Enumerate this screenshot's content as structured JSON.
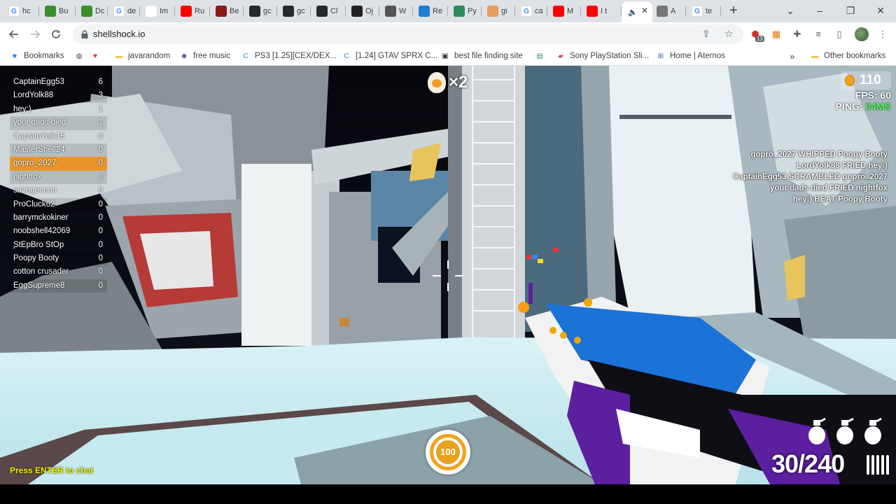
{
  "browser": {
    "tabs": [
      {
        "title": "hc",
        "icon": "google-icon",
        "color": "#ffffff"
      },
      {
        "title": "Bu",
        "icon": "minecraft-icon",
        "color": "#3c8f2a"
      },
      {
        "title": "Dc",
        "icon": "minecraft-icon",
        "color": "#3c8f2a"
      },
      {
        "title": "de",
        "icon": "google-icon",
        "color": "#ffffff"
      },
      {
        "title": "Im",
        "icon": "chart-icon",
        "color": "#ffffff"
      },
      {
        "title": "Ru",
        "icon": "youtube-icon",
        "color": "#ff0000"
      },
      {
        "title": "Be",
        "icon": "medium-icon",
        "color": "#8b1a1a"
      },
      {
        "title": "gc",
        "icon": "github-icon",
        "color": "#24292e"
      },
      {
        "title": "gc",
        "icon": "github-icon",
        "color": "#24292e"
      },
      {
        "title": "Cl",
        "icon": "github-icon",
        "color": "#24292e"
      },
      {
        "title": "Oj",
        "icon": "openai-icon",
        "color": "#222222"
      },
      {
        "title": "W",
        "icon": "globe-icon",
        "color": "#555555"
      },
      {
        "title": "Re",
        "icon": "react-icon",
        "color": "#1f7fd1"
      },
      {
        "title": "Py",
        "icon": "wolfram-icon",
        "color": "#2e8b57"
      },
      {
        "title": "gi",
        "icon": "hand-icon",
        "color": "#e89a5b"
      },
      {
        "title": "ca",
        "icon": "google-icon",
        "color": "#ffffff"
      },
      {
        "title": "M",
        "icon": "youtube-icon",
        "color": "#ff0000"
      },
      {
        "title": "I t",
        "icon": "youtube-icon",
        "color": "#ff0000"
      },
      {
        "title": "",
        "icon": "speaker-icon",
        "color": "#ffffff",
        "active": true
      },
      {
        "title": "A",
        "icon": "page-icon",
        "color": "#777777"
      },
      {
        "title": "te",
        "icon": "google-icon",
        "color": "#ffffff"
      }
    ],
    "new_tab": "+",
    "window_controls": {
      "dropdown": "⌄",
      "minimize": "–",
      "restore": "❐",
      "close": "✕"
    },
    "url": "shellshock.io",
    "bookmarks": [
      {
        "label": "Bookmarks",
        "icon": "star-icon",
        "color": "#1a73e8"
      },
      {
        "label": "",
        "icon": "globe-icon",
        "color": "#444444"
      },
      {
        "label": "",
        "icon": "heart-icon",
        "color": "#d93025"
      },
      {
        "label": "javarandom",
        "icon": "folder-icon",
        "color": "#f6c343"
      },
      {
        "label": "free music",
        "icon": "alien-icon",
        "color": "#4a4a8a"
      },
      {
        "label": "PS3 [1.25][CEX/DEX...",
        "icon": "c-icon",
        "color": "#1a8fd4"
      },
      {
        "label": "[1.24] GTAV SPRX C...",
        "icon": "c-icon",
        "color": "#1a8fd4"
      },
      {
        "label": "best file finding site",
        "icon": "archive-icon",
        "color": "#333333"
      },
      {
        "label": "",
        "icon": "app-icon",
        "color": "#2a9d6b"
      },
      {
        "label": "Sony PlayStation Sli...",
        "icon": "shopping-icon",
        "color": "#c64b8c"
      },
      {
        "label": "Home | Aternos",
        "icon": "grid-icon",
        "color": "#3a6ea5"
      },
      {
        "label": "Other bookmarks",
        "icon": "folder-icon",
        "color": "#f6c343"
      }
    ],
    "more_bookmarks": "»",
    "extension_badge": "13"
  },
  "game": {
    "scoreboard": [
      {
        "name": "CaptainEgg53",
        "score": "6"
      },
      {
        "name": "LordYolk88",
        "score": "3"
      },
      {
        "name": "hey:)",
        "score": "1"
      },
      {
        "name": "your dads died",
        "score": "1"
      },
      {
        "name": "CaptainYolk15",
        "score": "0"
      },
      {
        "name": "MasterShell24",
        "score": "0"
      },
      {
        "name": "gopro_2027",
        "score": "0",
        "me": true
      },
      {
        "name": "nightfox",
        "score": "0"
      },
      {
        "name": "savegecoon",
        "score": "0"
      },
      {
        "name": "ProCluck62",
        "score": "0"
      },
      {
        "name": "barrymckokiner",
        "score": "0"
      },
      {
        "name": "noobshell42069",
        "score": "0"
      },
      {
        "name": "StEpBro StOp",
        "score": "0"
      },
      {
        "name": "Poopy Booty",
        "score": "0"
      },
      {
        "name": "cotton crusader",
        "score": "0"
      },
      {
        "name": "EggSupreme8",
        "score": "0"
      }
    ],
    "killfeed": [
      "gopro_2027 WHIPPED Poopy Booty",
      "LordYolk88 FRIED hey:)",
      "CaptainEgg53 SCRAMBLED gopro_2027",
      "your dads died FRIED nightfox",
      "hey:) BEAT Poopy Booty"
    ],
    "coins": "110",
    "fps_label": "FPS: 60",
    "ping_label": "PING: ",
    "ping_value": "34MS",
    "streak": "×2",
    "health": "100",
    "health_fraction": 1.0,
    "grenades": 3,
    "ammo": "30/240",
    "chat_hint": "Press ENTER to chat",
    "colors": {
      "accent": "#e8962b",
      "ping_ok": "#4bff58",
      "chat_hint": "#f2f200",
      "gun_blue": "#1b73d8",
      "gun_purple": "#5b1fa0"
    }
  }
}
